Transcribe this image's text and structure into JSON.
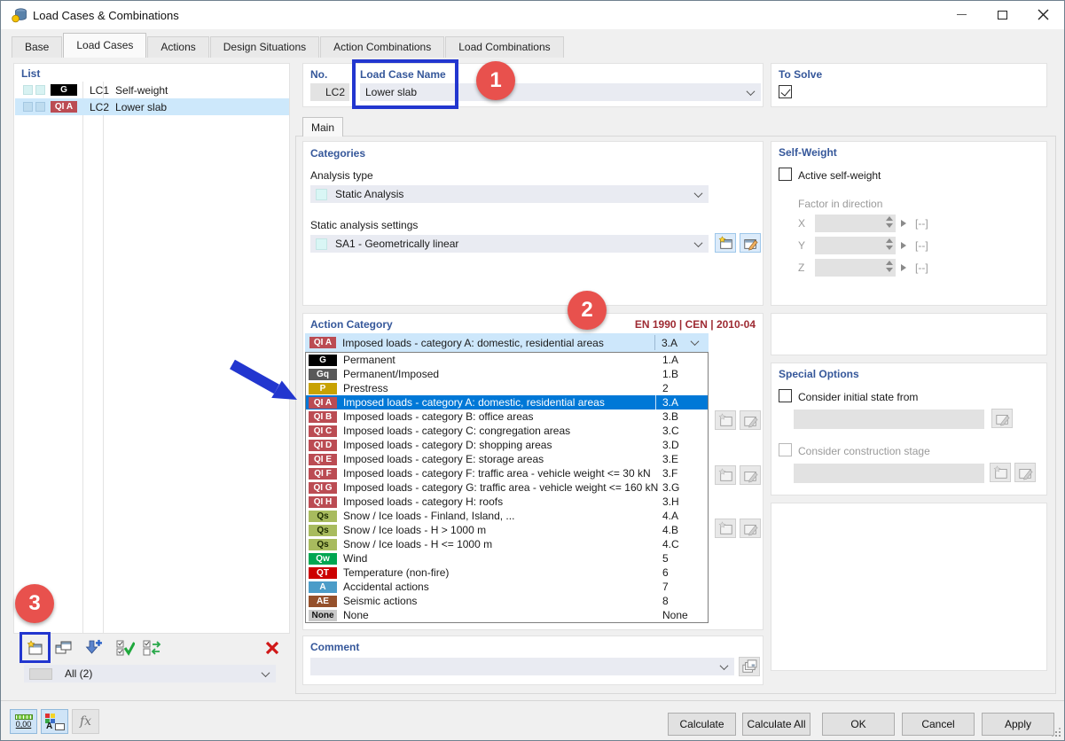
{
  "window": {
    "title": "Load Cases & Combinations"
  },
  "tabs": [
    {
      "label": "Base"
    },
    {
      "label": "Load Cases"
    },
    {
      "label": "Actions"
    },
    {
      "label": "Design Situations"
    },
    {
      "label": "Action Combinations"
    },
    {
      "label": "Load Combinations"
    }
  ],
  "list_panel": {
    "header": "List",
    "rows": [
      {
        "badge": "G",
        "lc": "LC1",
        "name": "Self-weight"
      },
      {
        "badge": "QI A",
        "lc": "LC2",
        "name": "Lower slab"
      }
    ],
    "filter_value": "All (2)"
  },
  "header_fields": {
    "no_label": "No.",
    "no_value": "LC2",
    "name_label": "Load Case Name",
    "name_value": "Lower slab"
  },
  "to_solve": {
    "header": "To Solve",
    "checked": true
  },
  "main_tab_label": "Main",
  "categories": {
    "header": "Categories",
    "analysis_type_label": "Analysis type",
    "analysis_type_value": "Static Analysis",
    "settings_label": "Static analysis settings",
    "settings_value": "SA1 - Geometrically linear"
  },
  "action_category": {
    "header": "Action Category",
    "standard": "EN 1990 | CEN | 2010-04",
    "selected": {
      "badge": "QI A",
      "label": "Imposed loads - category A: domestic, residential areas",
      "code": "3.A"
    },
    "items": [
      {
        "badge": "G",
        "label": "Permanent",
        "code": "1.A"
      },
      {
        "badge": "Gq",
        "label": "Permanent/Imposed",
        "code": "1.B"
      },
      {
        "badge": "P",
        "label": "Prestress",
        "code": "2"
      },
      {
        "badge": "QI A",
        "label": "Imposed loads - category A: domestic, residential areas",
        "code": "3.A",
        "highlighted": true
      },
      {
        "badge": "QI B",
        "label": "Imposed loads - category B: office areas",
        "code": "3.B"
      },
      {
        "badge": "QI C",
        "label": "Imposed loads - category C: congregation areas",
        "code": "3.C"
      },
      {
        "badge": "QI D",
        "label": "Imposed loads - category D: shopping areas",
        "code": "3.D"
      },
      {
        "badge": "QI E",
        "label": "Imposed loads - category E: storage areas",
        "code": "3.E"
      },
      {
        "badge": "QI F",
        "label": "Imposed loads - category F: traffic area - vehicle weight <= 30 kN",
        "code": "3.F"
      },
      {
        "badge": "QI G",
        "label": "Imposed loads - category G: traffic area - vehicle weight <= 160 kN",
        "code": "3.G"
      },
      {
        "badge": "QI H",
        "label": "Imposed loads - category H: roofs",
        "code": "3.H"
      },
      {
        "badge": "Qs",
        "label": "Snow / Ice loads - Finland, Island, ...",
        "code": "4.A"
      },
      {
        "badge": "Qs",
        "label": "Snow / Ice loads - H > 1000 m",
        "code": "4.B"
      },
      {
        "badge": "Qs",
        "label": "Snow / Ice loads - H <= 1000 m",
        "code": "4.C"
      },
      {
        "badge": "Qw",
        "label": "Wind",
        "code": "5"
      },
      {
        "badge": "QT",
        "label": "Temperature (non-fire)",
        "code": "6"
      },
      {
        "badge": "A",
        "label": "Accidental actions",
        "code": "7"
      },
      {
        "badge": "AE",
        "label": "Seismic actions",
        "code": "8"
      },
      {
        "badge": "None",
        "label": "None",
        "code": "None"
      }
    ]
  },
  "comment": {
    "header": "Comment",
    "value": ""
  },
  "self_weight": {
    "header": "Self-Weight",
    "active_label": "Active self-weight",
    "factor_label": "Factor in direction",
    "rows": [
      {
        "axis": "X",
        "value": "",
        "unit": "[--]"
      },
      {
        "axis": "Y",
        "value": "",
        "unit": "[--]"
      },
      {
        "axis": "Z",
        "value": "",
        "unit": "[--]"
      }
    ]
  },
  "special_options": {
    "header": "Special Options",
    "initial_state_label": "Consider initial state from",
    "construction_stage_label": "Consider construction stage"
  },
  "footer_buttons": {
    "calculate": "Calculate",
    "calculate_all": "Calculate All",
    "ok": "OK",
    "cancel": "Cancel",
    "apply": "Apply"
  },
  "status_bar": {
    "units_label": "0,00",
    "fx_label": "fx"
  },
  "annotations": {
    "step_1": "1",
    "step_2": "2",
    "step_3": "3"
  },
  "colors": {
    "accent_blue": "#0078d7",
    "selection_bg": "#cde8fb",
    "header_blue": "#35579a",
    "standard_red": "#9e2b33",
    "annotation_red": "#e8514d",
    "annotation_blue": "#2236cf",
    "badge_g": "#000000",
    "badge_gq": "#595959",
    "badge_p": "#c8a202",
    "badge_qi": "#bb4c53",
    "badge_qs": "#a8bb5e",
    "badge_qw": "#00a651",
    "badge_qt": "#cc0000",
    "badge_a": "#4b9cc8",
    "badge_ae": "#95502b",
    "badge_none": "#c9c9c9"
  }
}
